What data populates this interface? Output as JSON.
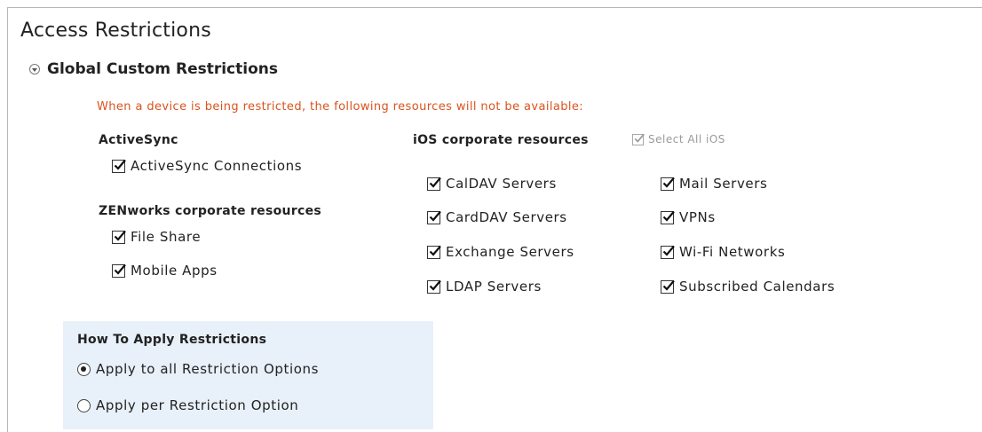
{
  "page": {
    "title": "Access Restrictions"
  },
  "section": {
    "title": "Global Custom Restrictions",
    "icon": "expand-toggle-icon"
  },
  "warning": "When a device is being restricted, the following resources will not be available:",
  "activesync": {
    "label": "ActiveSync",
    "items": [
      {
        "label": "ActiveSync Connections",
        "checked": true
      }
    ]
  },
  "zenworks": {
    "label": "ZENworks corporate resources",
    "items": [
      {
        "label": "File Share",
        "checked": true
      },
      {
        "label": "Mobile Apps",
        "checked": true
      }
    ]
  },
  "ios": {
    "label": "iOS corporate resources",
    "select_all_label": "Select All iOS",
    "select_all_checked": true,
    "col1": [
      {
        "label": "CalDAV Servers",
        "checked": true
      },
      {
        "label": "CardDAV Servers",
        "checked": true
      },
      {
        "label": "Exchange Servers",
        "checked": true
      },
      {
        "label": "LDAP Servers",
        "checked": true
      }
    ],
    "col2": [
      {
        "label": "Mail Servers",
        "checked": true
      },
      {
        "label": "VPNs",
        "checked": true
      },
      {
        "label": "Wi-Fi Networks",
        "checked": true
      },
      {
        "label": "Subscribed Calendars",
        "checked": true
      }
    ]
  },
  "apply": {
    "title": "How To Apply Restrictions",
    "options": [
      {
        "label": "Apply to all Restriction Options",
        "selected": true
      },
      {
        "label": "Apply per Restriction Option",
        "selected": false
      }
    ]
  }
}
